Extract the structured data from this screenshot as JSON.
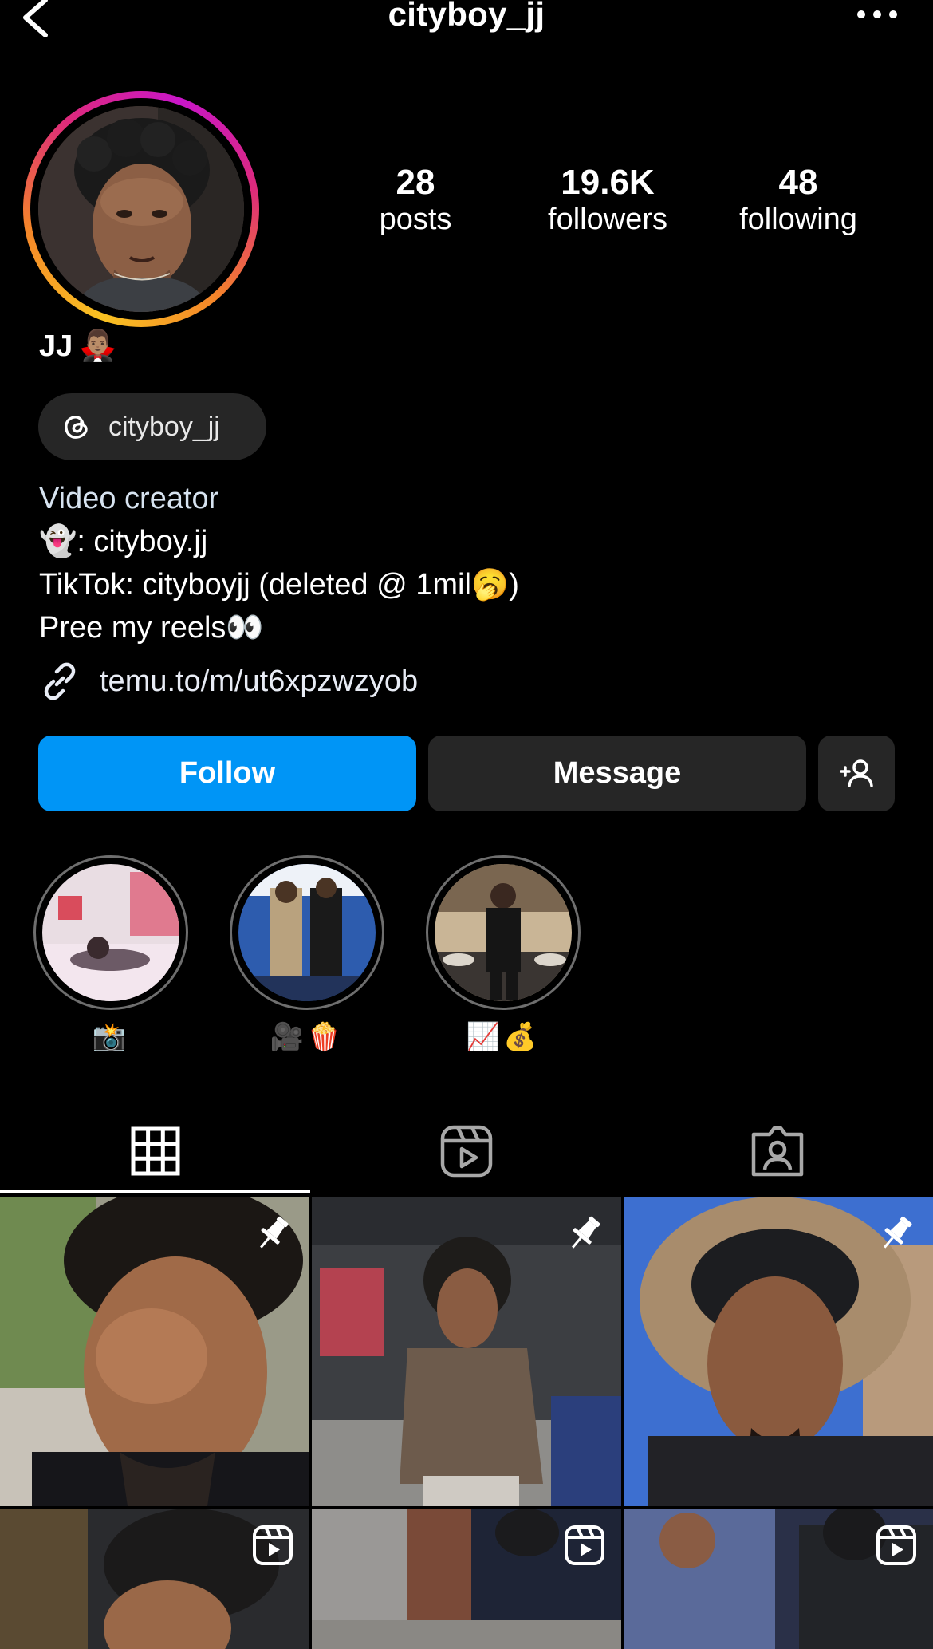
{
  "header": {
    "username": "cityboy_jj"
  },
  "profile": {
    "display_name": "JJ",
    "display_name_emoji": "🧛🏽‍♂️",
    "stats": [
      {
        "value": "28",
        "label": "posts"
      },
      {
        "value": "19.6K",
        "label": "followers"
      },
      {
        "value": "48",
        "label": "following"
      }
    ],
    "threads_handle": "cityboy_jj",
    "bio": {
      "category": "Video creator",
      "line1": "👻: cityboy.jj",
      "line2": "TikTok: cityboyjj (deleted @ 1mil🥱)",
      "line3": "Pree my reels👀"
    },
    "link": "temu.to/m/ut6xpzwzyob"
  },
  "actions": {
    "follow": "Follow",
    "message": "Message"
  },
  "highlights": [
    {
      "label": "📸"
    },
    {
      "label": "🎥🍿"
    },
    {
      "label": "📈💰"
    }
  ],
  "tabs": [
    "posts-grid",
    "reels",
    "tagged"
  ],
  "grid": [
    {
      "type": "pinned"
    },
    {
      "type": "pinned"
    },
    {
      "type": "pinned"
    },
    {
      "type": "reel"
    },
    {
      "type": "reel"
    },
    {
      "type": "reel"
    }
  ],
  "colors": {
    "follow_blue": "#0095f6",
    "chip_gray": "#262626"
  }
}
